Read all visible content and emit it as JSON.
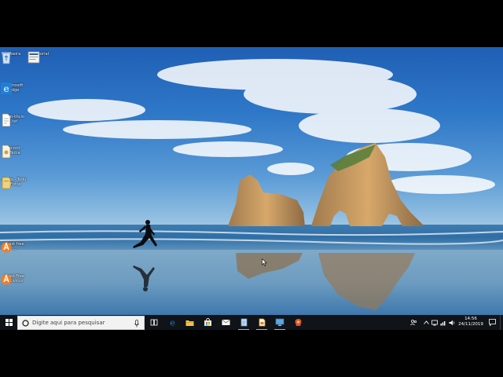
{
  "desktop": {
    "icons": [
      {
        "name": "recycle-bin-icon",
        "label": "Lixeira"
      },
      {
        "name": "tutorial-icon",
        "label": "tutorial"
      },
      {
        "name": "microsoft-edge-icon",
        "label": "Microsoft\nEdge"
      },
      {
        "name": "text-file-icon",
        "label": "Sem-título\n.txt"
      },
      {
        "name": "record-icon",
        "label": "Record -\nMinha"
      },
      {
        "name": "folder-icon",
        "label": "Ajuda - Todo\n- Fotos"
      },
      {
        "name": "avast-icon",
        "label": "avast free\n..."
      },
      {
        "name": "avast-antivirus-icon",
        "label": "Avast Free\nAntivirus"
      }
    ]
  },
  "taskbar": {
    "search_placeholder": "Digite aqui para pesquisar",
    "apps": [
      {
        "name": "task-view-icon"
      },
      {
        "name": "edge-icon"
      },
      {
        "name": "file-explorer-icon"
      },
      {
        "name": "store-icon"
      },
      {
        "name": "mail-icon"
      },
      {
        "name": "app-blue-icon"
      },
      {
        "name": "document-app-icon"
      },
      {
        "name": "remote-desktop-icon"
      },
      {
        "name": "orange-app-icon"
      }
    ],
    "clock": {
      "time": "14:56",
      "date": "24/11/2019"
    }
  },
  "colors": {
    "taskbar": "#101418",
    "search_box": "#f2f2f2",
    "edge_blue": "#1e7fd6",
    "avast_orange": "#f57c1f"
  }
}
